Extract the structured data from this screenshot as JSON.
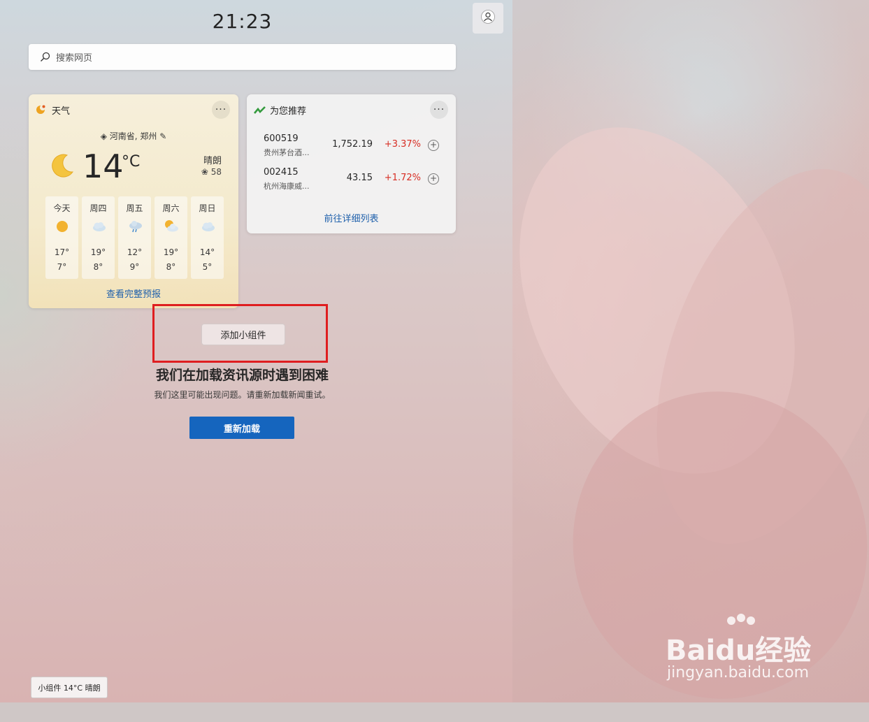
{
  "clock": "21:23",
  "search": {
    "placeholder": "搜索网页"
  },
  "weather": {
    "title": "天气",
    "more": "···",
    "location": "河南省, 郑州",
    "temperature": "14",
    "unit": "°C",
    "condition": "晴朗",
    "aqi": "58",
    "forecast": [
      {
        "day": "今天",
        "icon": "sun-icon",
        "high": "17°",
        "low": "7°"
      },
      {
        "day": "周四",
        "icon": "cloud-icon",
        "high": "19°",
        "low": "8°"
      },
      {
        "day": "周五",
        "icon": "rain-icon",
        "high": "12°",
        "low": "9°"
      },
      {
        "day": "周六",
        "icon": "partly-cloudy-icon",
        "high": "19°",
        "low": "8°"
      },
      {
        "day": "周日",
        "icon": "cloud-icon",
        "high": "14°",
        "low": "5°"
      }
    ],
    "full_forecast_link": "查看完整预报"
  },
  "stocks": {
    "title": "为您推荐",
    "more": "···",
    "items": [
      {
        "symbol": "600519",
        "name": "贵州茅台酒...",
        "price": "1,752.19",
        "change": "+3.37%"
      },
      {
        "symbol": "002415",
        "name": "杭州海康威...",
        "price": "43.15",
        "change": "+1.72%"
      }
    ],
    "details_link": "前往详细列表"
  },
  "add_widget_label": "添加小组件",
  "error": {
    "title": "我们在加载资讯源时遇到困难",
    "message": "我们这里可能出现问题。请重新加载新闻重试。",
    "reload_label": "重新加载"
  },
  "taskbar_tip": "小组件 14°C 晴朗",
  "watermark": {
    "brand": "Baidu经验",
    "url": "jingyan.baidu.com"
  },
  "colors": {
    "accent_blue": "#0f63bf",
    "link_blue": "#1a5dab",
    "stock_up_red": "#d8291e",
    "highlight_red": "#e0191b"
  }
}
